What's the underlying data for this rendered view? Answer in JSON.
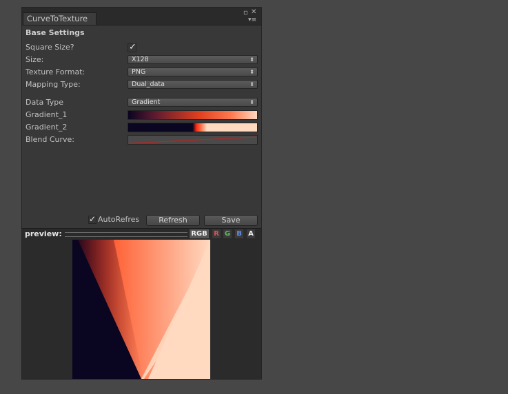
{
  "window": {
    "tab_title": "CurveToTexture",
    "dock_icon": "maximize-icon",
    "close_icon": "close-icon",
    "menu_icon": "menu-icon"
  },
  "base_settings": {
    "title": "Base Settings",
    "square_size_label": "Square Size?",
    "square_size_checked": true,
    "size_label": "Size:",
    "size_value": "X128",
    "texture_format_label": "Texture Format:",
    "texture_format_value": "PNG",
    "mapping_type_label": "Mapping Type:",
    "mapping_type_value": "Dual_data"
  },
  "data": {
    "data_type_label": "Data Type",
    "data_type_value": "Gradient",
    "gradient_1_label": "Gradient_1",
    "gradient_2_label": "Gradient_2",
    "blend_curve_label": "Blend Curve:"
  },
  "actions": {
    "autorefresh_label": "AutoRefres",
    "autorefresh_checked": true,
    "refresh_label": "Refresh",
    "save_label": "Save"
  },
  "preview": {
    "label": "preview:",
    "channels": [
      "RGB",
      "R",
      "G",
      "B",
      "A"
    ],
    "selected_channel": "RGB"
  },
  "colors": {
    "gradient_dark": "#0a0520",
    "gradient_red": "#ff2a10",
    "gradient_peach": "#ffd9c0",
    "curve": "#c82020"
  }
}
